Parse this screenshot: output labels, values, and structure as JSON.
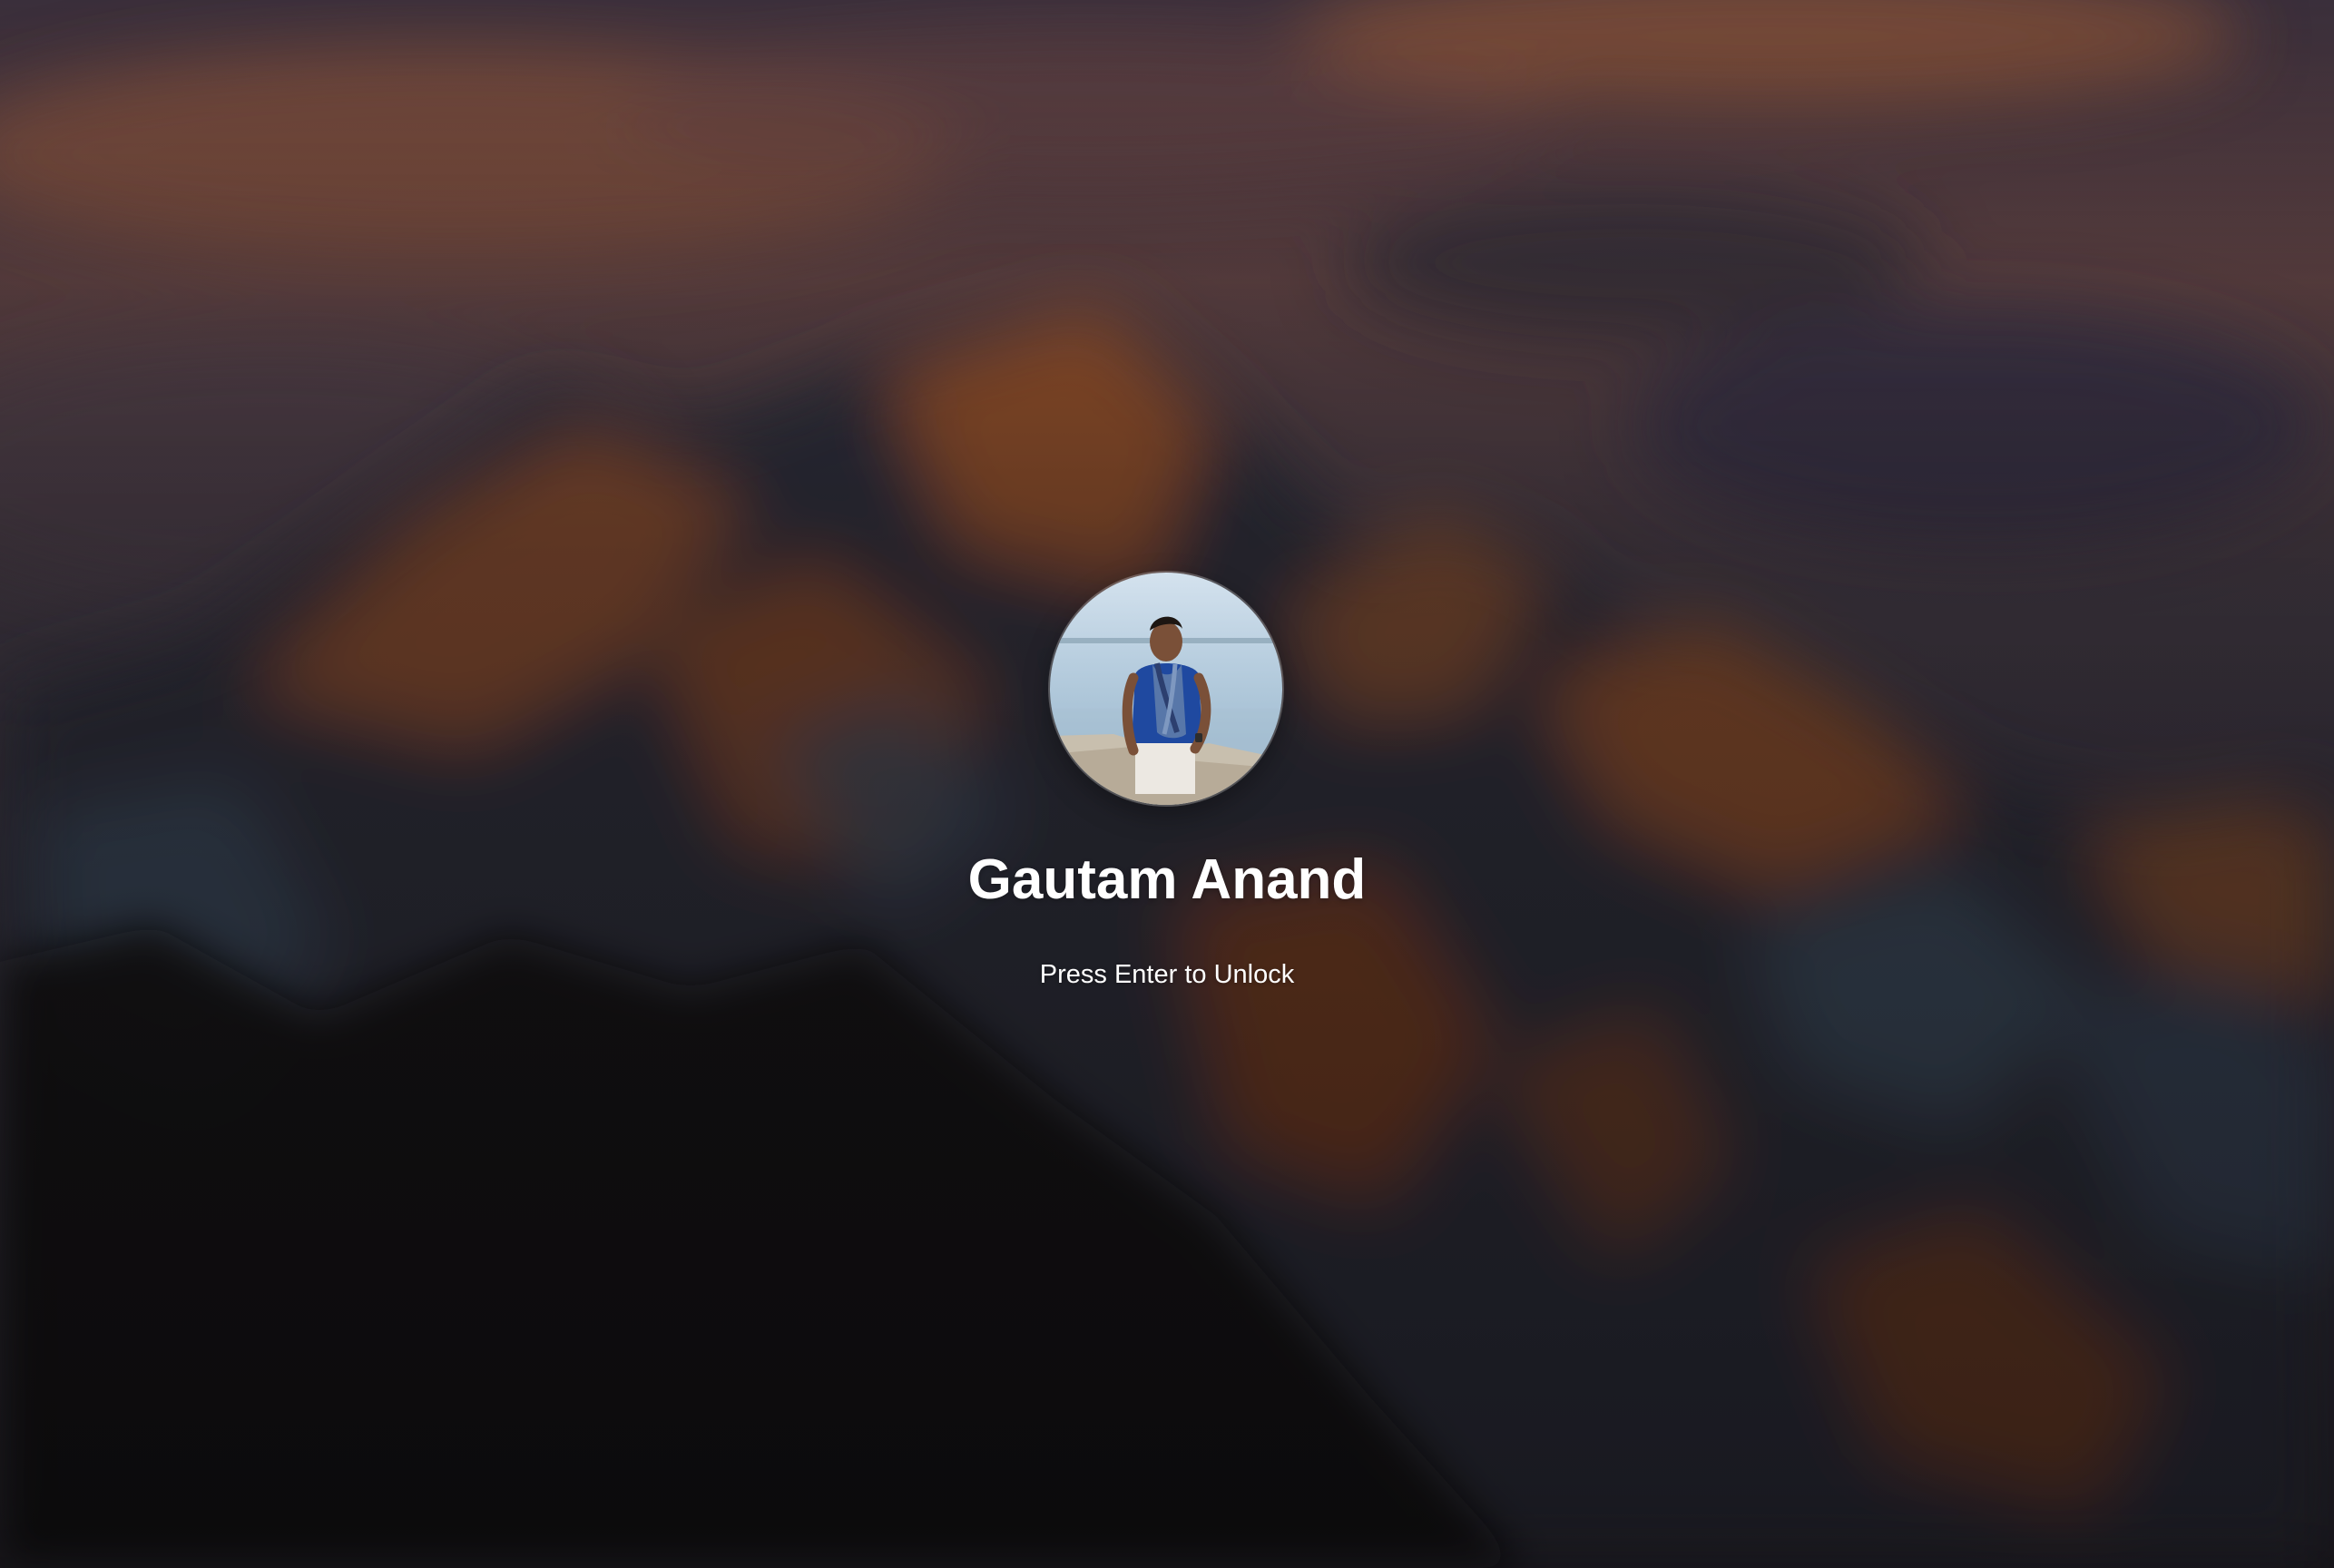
{
  "lock_screen": {
    "user": {
      "name": "Gautam Anand",
      "avatar_icon": "user-avatar-photo"
    },
    "hint": "Press Enter to Unlock"
  },
  "colors": {
    "text": "#ffffff",
    "sky_purple": "#4a3b52",
    "sky_orange": "#8a4f3a",
    "mountain_orange": "#a95a2a",
    "mountain_blue": "#3c4a5c",
    "foreground_dark": "#120e0e"
  }
}
